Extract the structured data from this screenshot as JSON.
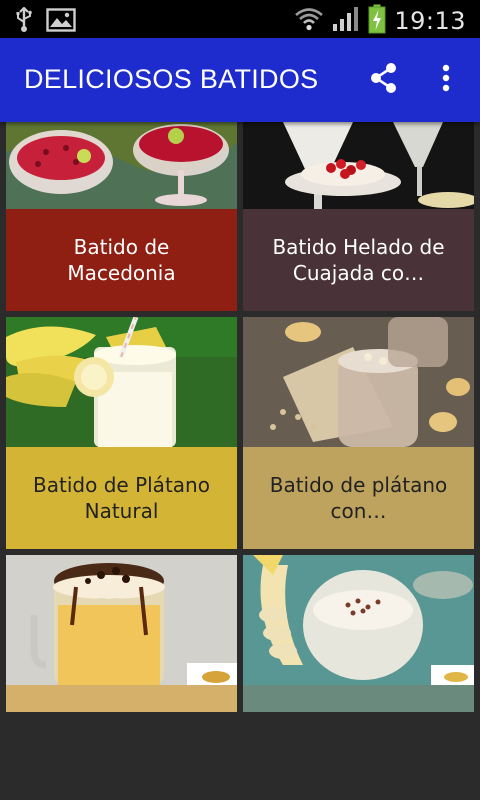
{
  "status_bar": {
    "time": "19:13",
    "icons": [
      "usb-icon",
      "image-icon",
      "wifi-icon",
      "signal-icon",
      "battery-charging-icon"
    ]
  },
  "app_bar": {
    "title": "DELICIOSOS BATIDOS",
    "actions": [
      "share-icon",
      "more-vert-icon"
    ]
  },
  "recipes": [
    {
      "title": "Batido de Macedonia",
      "caption_color": "#8e1f12"
    },
    {
      "title": "Batido Helado de Cuajada co…",
      "caption_color": "#4a3338"
    },
    {
      "title": "Batido de Plátano Natural",
      "caption_color": "#d4b435"
    },
    {
      "title": "Batido de plátano con…",
      "caption_color": "#bda35d"
    },
    {
      "title": "",
      "caption_color": "#d4b06a"
    },
    {
      "title": "",
      "caption_color": "#6a8a7e"
    }
  ]
}
